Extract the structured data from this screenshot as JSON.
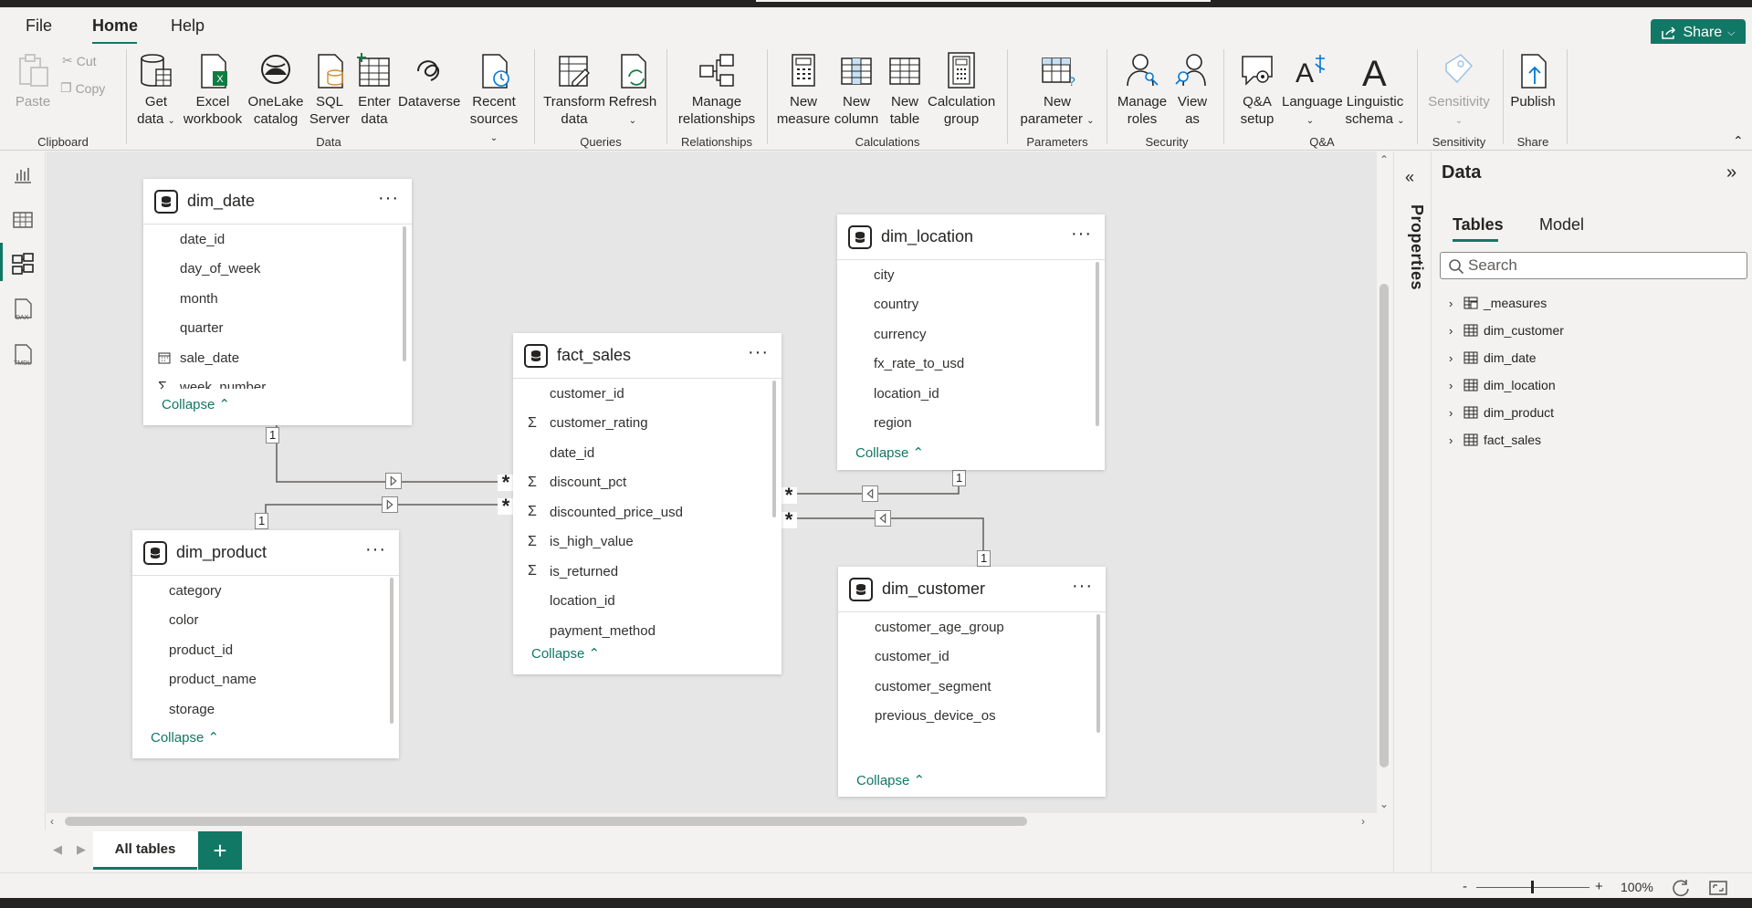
{
  "menu": {
    "file": "File",
    "home": "Home",
    "help": "Help",
    "share": "Share"
  },
  "ribbon": {
    "clipboard": {
      "paste": "Paste",
      "cut": "Cut",
      "copy": "Copy",
      "label": "Clipboard"
    },
    "data": {
      "get_data": "Get data",
      "excel": "Excel workbook",
      "onelake": "OneLake catalog",
      "sql": "SQL Server",
      "enter": "Enter data",
      "dataverse": "Dataverse",
      "recent": "Recent sources",
      "label": "Data"
    },
    "queries": {
      "transform": "Transform data",
      "refresh": "Refresh",
      "label": "Queries"
    },
    "relationships": {
      "manage": "Manage relationships",
      "label": "Relationships"
    },
    "calculations": {
      "new_measure": "New measure",
      "new_column": "New column",
      "new_table": "New table",
      "calc_group": "Calculation group",
      "label": "Calculations"
    },
    "parameters": {
      "new_parameter": "New parameter",
      "label": "Parameters"
    },
    "security": {
      "manage_roles": "Manage roles",
      "view_as": "View as",
      "label": "Security"
    },
    "qa": {
      "qa_setup": "Q&A setup",
      "language": "Language",
      "linguistic": "Linguistic schema",
      "label": "Q&A"
    },
    "sensitivity": {
      "sensitivity": "Sensitivity",
      "label": "Sensitivity"
    },
    "share": {
      "publish": "Publish",
      "label": "Share"
    }
  },
  "tables": {
    "dim_date": {
      "name": "dim_date",
      "fields": [
        "date_id",
        "day_of_week",
        "month",
        "quarter",
        "sale_date",
        "week_number"
      ],
      "collapse": "Collapse"
    },
    "fact_sales": {
      "name": "fact_sales",
      "fields": [
        "customer_id",
        "customer_rating",
        "date_id",
        "discount_pct",
        "discounted_price_usd",
        "is_high_value",
        "is_returned",
        "location_id",
        "payment_method"
      ],
      "collapse": "Collapse"
    },
    "dim_location": {
      "name": "dim_location",
      "fields": [
        "city",
        "country",
        "currency",
        "fx_rate_to_usd",
        "location_id",
        "region"
      ],
      "collapse": "Collapse"
    },
    "dim_product": {
      "name": "dim_product",
      "fields": [
        "category",
        "color",
        "product_id",
        "product_name",
        "storage"
      ],
      "collapse": "Collapse"
    },
    "dim_customer": {
      "name": "dim_customer",
      "fields": [
        "customer_age_group",
        "customer_id",
        "customer_segment",
        "previous_device_os"
      ],
      "collapse": "Collapse"
    }
  },
  "relationships": {
    "one": "1",
    "many": "*"
  },
  "tabs": {
    "all_tables": "All tables",
    "add": "+"
  },
  "properties": {
    "label": "Properties"
  },
  "data_pane": {
    "title": "Data",
    "tab_tables": "Tables",
    "tab_model": "Model",
    "search_placeholder": "Search",
    "items": [
      "_measures",
      "dim_customer",
      "dim_date",
      "dim_location",
      "dim_product",
      "fact_sales"
    ]
  },
  "status": {
    "zoom": "100%",
    "zoom_minus": "-",
    "zoom_plus": "+"
  },
  "colors": {
    "accent": "#117865",
    "canvas": "#e6e6e6",
    "chrome": "#f3f2f1"
  }
}
